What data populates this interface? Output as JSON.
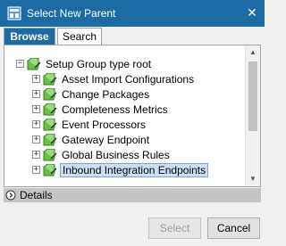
{
  "dialog": {
    "title": "Select New Parent"
  },
  "tabs": [
    {
      "label": "Browse",
      "active": true
    },
    {
      "label": "Search",
      "active": false
    }
  ],
  "tree": {
    "root": {
      "label": "Setup Group type root",
      "expander": "−"
    },
    "children": [
      {
        "label": "Asset Import Configurations",
        "expander": "+"
      },
      {
        "label": "Change Packages",
        "expander": "+"
      },
      {
        "label": "Completeness Metrics",
        "expander": "+"
      },
      {
        "label": "Event Processors",
        "expander": "+"
      },
      {
        "label": "Gateway Endpoint",
        "expander": "+"
      },
      {
        "label": "Global Business Rules",
        "expander": "+"
      },
      {
        "label": "Inbound Integration Endpoints",
        "expander": "+",
        "selected": true
      }
    ]
  },
  "details": {
    "label": "Details"
  },
  "buttons": {
    "select": "Select",
    "cancel": "Cancel"
  },
  "colors": {
    "titlebar": "#1c6ba3",
    "folder_icon": "#5bb53a",
    "selection": "#cce0f5"
  }
}
